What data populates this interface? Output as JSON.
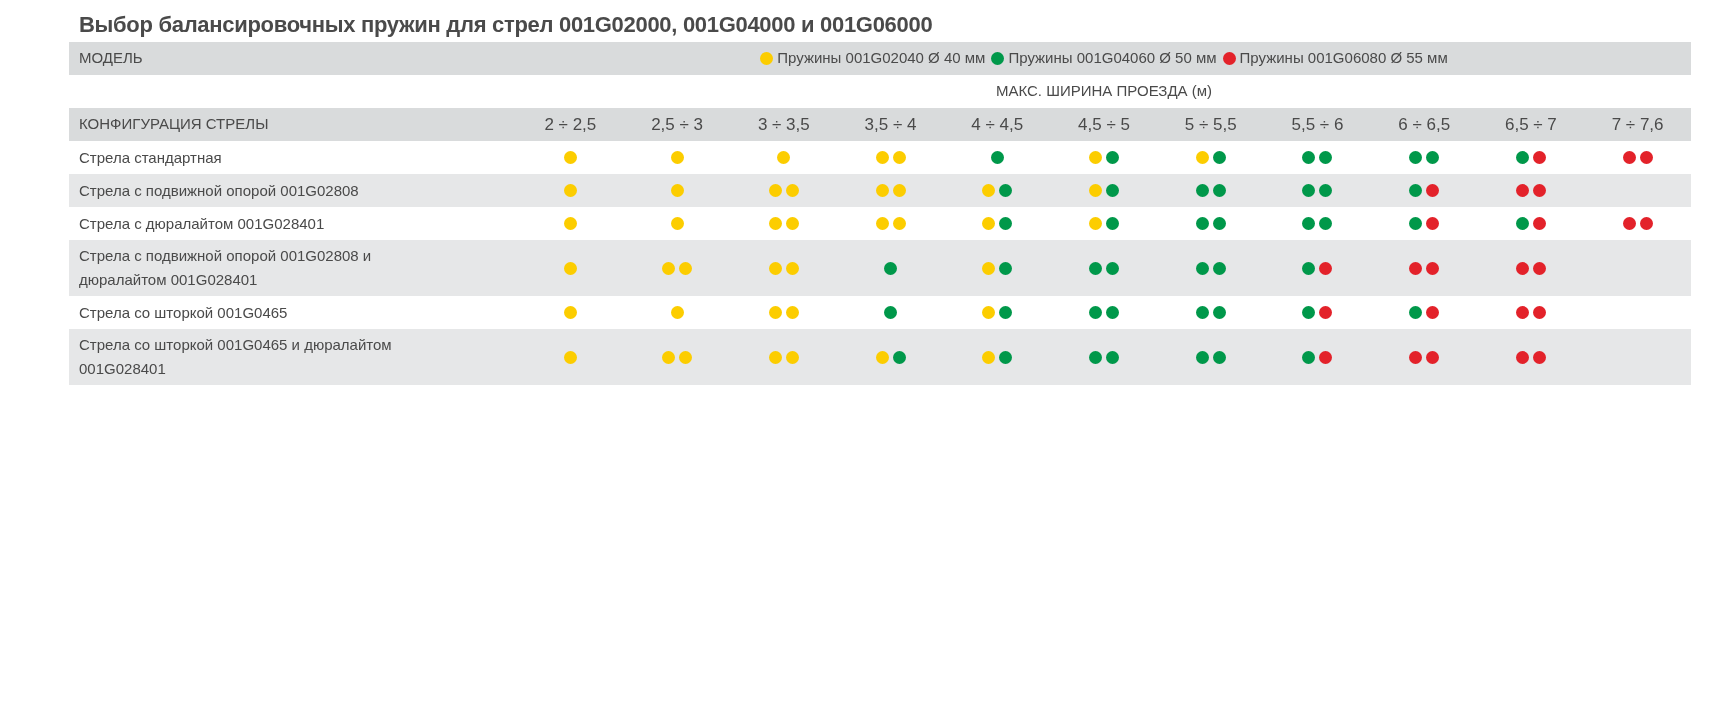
{
  "title": "Выбор балансировочных пружин для стрел 001G02000, 001G04000 и 001G06000",
  "model_label": "МОДЕЛЬ",
  "legend": [
    {
      "label": "Пружины 001G02040 Ø 40 мм",
      "color": "#fccd00"
    },
    {
      "label": "Пружины 001G04060 Ø 50 мм",
      "color": "#00984a"
    },
    {
      "label": "Пружины 001G06080 Ø 55 мм",
      "color": "#e3222a"
    }
  ],
  "width_caption": "МАКС. ШИРИНА ПРОЕЗДА (м)",
  "config_label": "КОНФИГУРАЦИЯ СТРЕЛЫ",
  "columns": [
    "2 ÷ 2,5",
    "2,5 ÷ 3",
    "3 ÷ 3,5",
    "3,5 ÷ 4",
    "4 ÷ 4,5",
    "4,5 ÷ 5",
    "5 ÷ 5,5",
    "5,5 ÷ 6",
    "6 ÷ 6,5",
    "6,5 ÷ 7",
    "7 ÷ 7,6"
  ],
  "rows": [
    {
      "label": "Стрела стандартная",
      "cells": [
        {
          "dots": [
            {
              "color": "#fccd00"
            }
          ]
        },
        {
          "dots": [
            {
              "color": "#fccd00"
            }
          ]
        },
        {
          "dots": [
            {
              "color": "#fccd00"
            }
          ]
        },
        {
          "dots": [
            {
              "color": "#fccd00"
            },
            {
              "color": "#fccd00"
            }
          ]
        },
        {
          "dots": [
            {
              "color": "#00984a"
            }
          ]
        },
        {
          "dots": [
            {
              "color": "#fccd00"
            },
            {
              "color": "#00984a"
            }
          ]
        },
        {
          "dots": [
            {
              "color": "#fccd00"
            },
            {
              "color": "#00984a"
            }
          ]
        },
        {
          "dots": [
            {
              "color": "#00984a"
            },
            {
              "color": "#00984a"
            }
          ]
        },
        {
          "dots": [
            {
              "color": "#00984a"
            },
            {
              "color": "#00984a"
            }
          ]
        },
        {
          "dots": [
            {
              "color": "#00984a"
            },
            {
              "color": "#e3222a"
            }
          ]
        },
        {
          "dots": [
            {
              "color": "#e3222a"
            },
            {
              "color": "#e3222a"
            }
          ]
        }
      ]
    },
    {
      "label": "Стрела с подвижной опорой 001G02808",
      "cells": [
        {
          "dots": [
            {
              "color": "#fccd00"
            }
          ]
        },
        {
          "dots": [
            {
              "color": "#fccd00"
            }
          ]
        },
        {
          "dots": [
            {
              "color": "#fccd00"
            },
            {
              "color": "#fccd00"
            }
          ]
        },
        {
          "dots": [
            {
              "color": "#fccd00"
            },
            {
              "color": "#fccd00"
            }
          ]
        },
        {
          "dots": [
            {
              "color": "#fccd00"
            },
            {
              "color": "#00984a"
            }
          ]
        },
        {
          "dots": [
            {
              "color": "#fccd00"
            },
            {
              "color": "#00984a"
            }
          ]
        },
        {
          "dots": [
            {
              "color": "#00984a"
            },
            {
              "color": "#00984a"
            }
          ]
        },
        {
          "dots": [
            {
              "color": "#00984a"
            },
            {
              "color": "#00984a"
            }
          ]
        },
        {
          "dots": [
            {
              "color": "#00984a"
            },
            {
              "color": "#e3222a"
            }
          ]
        },
        {
          "dots": [
            {
              "color": "#e3222a"
            },
            {
              "color": "#e3222a"
            }
          ]
        }
      ]
    },
    {
      "label": "Стрела с дюралайтом 001G028401",
      "cells": [
        {
          "dots": [
            {
              "color": "#fccd00"
            }
          ]
        },
        {
          "dots": [
            {
              "color": "#fccd00"
            }
          ]
        },
        {
          "dots": [
            {
              "color": "#fccd00"
            },
            {
              "color": "#fccd00"
            }
          ]
        },
        {
          "dots": [
            {
              "color": "#fccd00"
            },
            {
              "color": "#fccd00"
            }
          ]
        },
        {
          "dots": [
            {
              "color": "#fccd00"
            },
            {
              "color": "#00984a"
            }
          ]
        },
        {
          "dots": [
            {
              "color": "#fccd00"
            },
            {
              "color": "#00984a"
            }
          ]
        },
        {
          "dots": [
            {
              "color": "#00984a"
            },
            {
              "color": "#00984a"
            }
          ]
        },
        {
          "dots": [
            {
              "color": "#00984a"
            },
            {
              "color": "#00984a"
            }
          ]
        },
        {
          "dots": [
            {
              "color": "#00984a"
            },
            {
              "color": "#e3222a"
            }
          ]
        },
        {
          "dots": [
            {
              "color": "#00984a"
            },
            {
              "color": "#e3222a"
            }
          ]
        },
        {
          "dots": [
            {
              "color": "#e3222a"
            },
            {
              "color": "#e3222a"
            }
          ]
        }
      ]
    },
    {
      "label": "Стрела с подвижной опорой 001G02808 и дюралайтом 001G028401",
      "cells": [
        {
          "dots": [
            {
              "color": "#fccd00"
            }
          ]
        },
        {
          "dots": [
            {
              "color": "#fccd00"
            },
            {
              "color": "#fccd00"
            }
          ]
        },
        {
          "dots": [
            {
              "color": "#fccd00"
            },
            {
              "color": "#fccd00"
            }
          ]
        },
        {
          "dots": [
            {
              "color": "#00984a"
            }
          ]
        },
        {
          "dots": [
            {
              "color": "#fccd00"
            },
            {
              "color": "#00984a"
            }
          ]
        },
        {
          "dots": [
            {
              "color": "#00984a"
            },
            {
              "color": "#00984a"
            }
          ]
        },
        {
          "dots": [
            {
              "color": "#00984a"
            },
            {
              "color": "#00984a"
            }
          ]
        },
        {
          "dots": [
            {
              "color": "#00984a"
            },
            {
              "color": "#e3222a"
            }
          ]
        },
        {
          "dots": [
            {
              "color": "#e3222a"
            },
            {
              "color": "#e3222a"
            }
          ]
        },
        {
          "dots": [
            {
              "color": "#e3222a"
            },
            {
              "color": "#e3222a"
            }
          ]
        }
      ]
    },
    {
      "label": "Стрела со шторкой 001G0465",
      "cells": [
        {
          "dots": [
            {
              "color": "#fccd00"
            }
          ]
        },
        {
          "dots": [
            {
              "color": "#fccd00"
            }
          ]
        },
        {
          "dots": [
            {
              "color": "#fccd00"
            },
            {
              "color": "#fccd00"
            }
          ]
        },
        {
          "dots": [
            {
              "color": "#00984a"
            }
          ]
        },
        {
          "dots": [
            {
              "color": "#fccd00"
            },
            {
              "color": "#00984a"
            }
          ]
        },
        {
          "dots": [
            {
              "color": "#00984a"
            },
            {
              "color": "#00984a"
            }
          ]
        },
        {
          "dots": [
            {
              "color": "#00984a"
            },
            {
              "color": "#00984a"
            }
          ]
        },
        {
          "dots": [
            {
              "color": "#00984a"
            },
            {
              "color": "#e3222a"
            }
          ]
        },
        {
          "dots": [
            {
              "color": "#00984a"
            },
            {
              "color": "#e3222a"
            }
          ]
        },
        {
          "dots": [
            {
              "color": "#e3222a"
            },
            {
              "color": "#e3222a"
            }
          ]
        }
      ]
    },
    {
      "label": "Стрела со шторкой 001G0465 и дюралайтом 001G028401",
      "cells": [
        {
          "dots": [
            {
              "color": "#fccd00"
            }
          ]
        },
        {
          "dots": [
            {
              "color": "#fccd00"
            },
            {
              "color": "#fccd00"
            }
          ]
        },
        {
          "dots": [
            {
              "color": "#fccd00"
            },
            {
              "color": "#fccd00"
            }
          ]
        },
        {
          "dots": [
            {
              "color": "#fccd00"
            },
            {
              "color": "#00984a"
            }
          ]
        },
        {
          "dots": [
            {
              "color": "#fccd00"
            },
            {
              "color": "#00984a"
            }
          ]
        },
        {
          "dots": [
            {
              "color": "#00984a"
            },
            {
              "color": "#00984a"
            }
          ]
        },
        {
          "dots": [
            {
              "color": "#00984a"
            },
            {
              "color": "#00984a"
            }
          ]
        },
        {
          "dots": [
            {
              "color": "#00984a"
            },
            {
              "color": "#e3222a"
            }
          ]
        },
        {
          "dots": [
            {
              "color": "#e3222a"
            },
            {
              "color": "#e3222a"
            }
          ]
        },
        {
          "dots": [
            {
              "color": "#e3222a"
            },
            {
              "color": "#e3222a"
            }
          ]
        }
      ]
    }
  ]
}
